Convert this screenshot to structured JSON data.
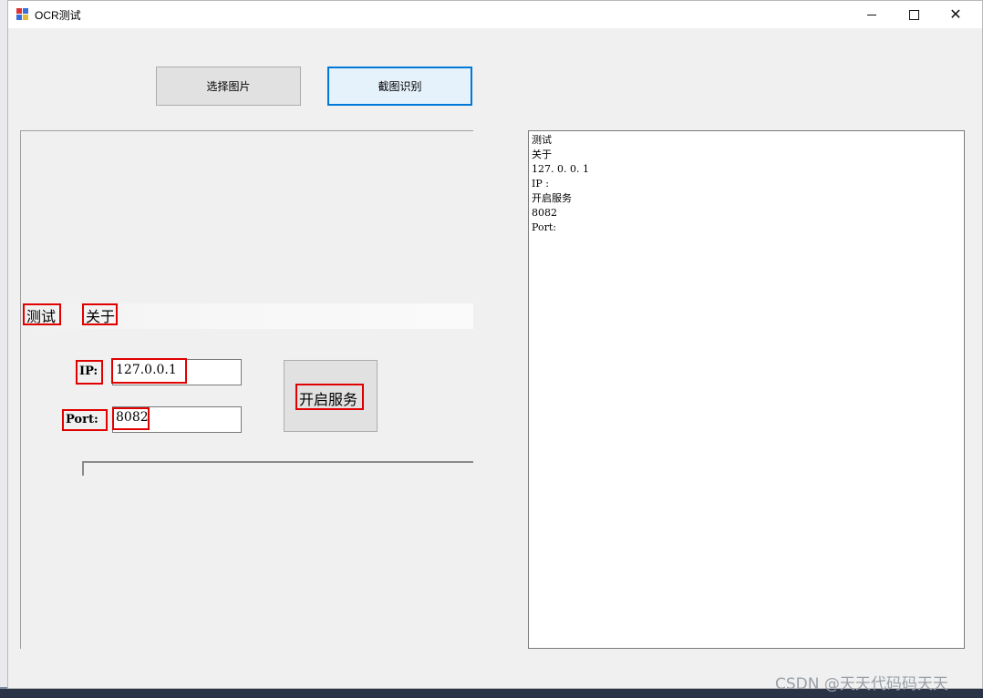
{
  "window": {
    "title": "OCR测试"
  },
  "toolbar": {
    "select_image_label": "选择图片",
    "capture_ocr_label": "截图识别"
  },
  "picture": {
    "menu": [
      "测试",
      "关于"
    ],
    "ip_label": "IP:",
    "ip_value": "127.0.0.1",
    "port_label": "Port:",
    "port_value": "8082",
    "start_service_label": "开启服务"
  },
  "result": {
    "lines": [
      "测试",
      "关于",
      "127. 0. 0. 1",
      "IP :",
      "开启服务",
      "8082",
      "Port:"
    ]
  },
  "watermark": "CSDN @天天代码码天天",
  "colors": {
    "highlight": "#e00000",
    "focus_border": "#0078d7"
  }
}
